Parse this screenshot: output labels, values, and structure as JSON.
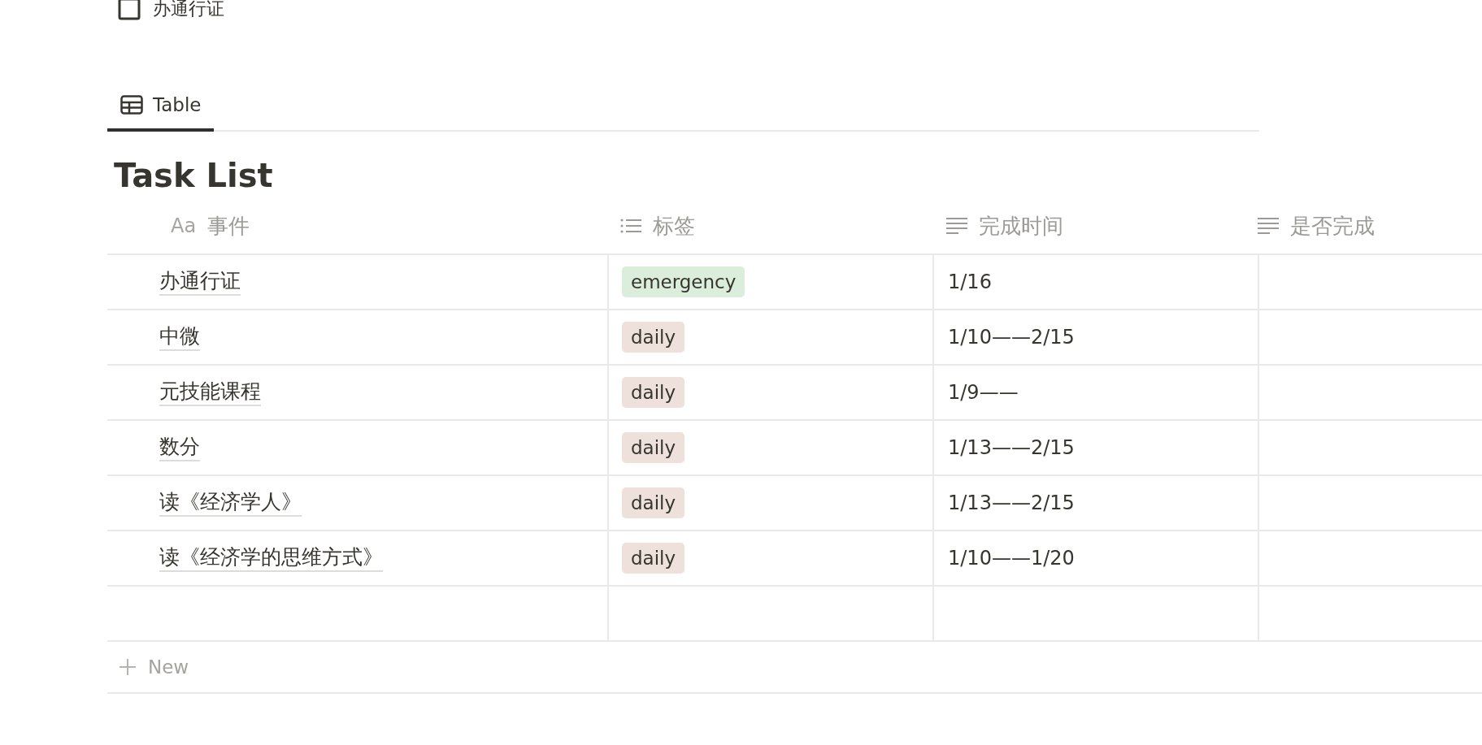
{
  "page_link": {
    "title": "办通行证"
  },
  "tabs": [
    {
      "label": "Table",
      "selected": true
    }
  ],
  "table": {
    "title": "Task List",
    "columns": [
      {
        "label": "事件",
        "kind": "title",
        "icon_text": "Aa"
      },
      {
        "label": "标签",
        "kind": "multi_select"
      },
      {
        "label": "完成时间",
        "kind": "text"
      },
      {
        "label": "是否完成",
        "kind": "text"
      }
    ],
    "rows": [
      {
        "event": "办通行证",
        "tag": {
          "label": "emergency",
          "color": "#dbeddb"
        },
        "time": "1/16"
      },
      {
        "event": "中微",
        "tag": {
          "label": "daily",
          "color": "#eee0da"
        },
        "time": "1/10——2/15"
      },
      {
        "event": "元技能课程",
        "tag": {
          "label": "daily",
          "color": "#eee0da"
        },
        "time": "1/9——"
      },
      {
        "event": "数分",
        "tag": {
          "label": "daily",
          "color": "#eee0da"
        },
        "time": "1/13——2/15"
      },
      {
        "event": "读《经济学人》",
        "tag": {
          "label": "daily",
          "color": "#eee0da"
        },
        "time": "1/13——2/15"
      },
      {
        "event": "读《经济学的思维方式》",
        "tag": {
          "label": "daily",
          "color": "#eee0da"
        },
        "time": "1/10——1/20"
      }
    ],
    "new_row": "New"
  }
}
